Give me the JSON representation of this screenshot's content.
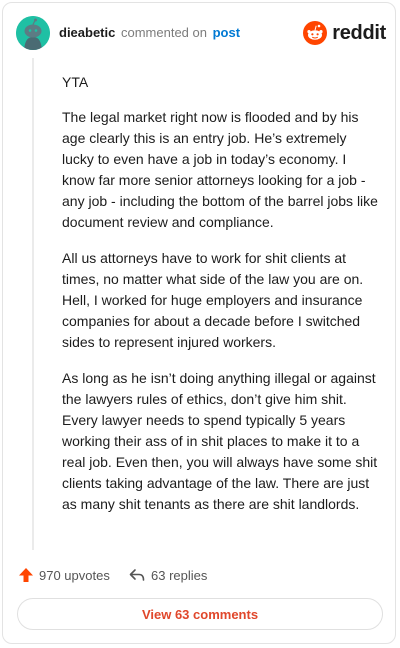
{
  "header": {
    "username": "dieabetic",
    "verb": "commented on",
    "post_link": "post",
    "brand": "reddit"
  },
  "comment": {
    "paragraphs": [
      "YTA",
      "The legal market right now is flooded and by his age clearly this is an entry job. He’s extremely lucky to even have a job in today’s economy. I know far more senior attorneys looking for a job - any job - including the bottom of the barrel jobs like document review and compliance.",
      "All us attorneys have to work for shit clients at times, no matter what side of the law you are on. Hell, I worked for huge employers and insurance companies for about a decade before I switched sides to represent injured workers.",
      "As long as he isn’t doing anything illegal or against the lawyers rules of ethics, don’t give him shit. Every lawyer needs to spend typically 5 years working their ass of in shit places to make it to a real job. Even then, you will always have some shit clients taking advantage of the law. There are just as many shit tenants as there are shit landlords."
    ]
  },
  "actions": {
    "upvotes": "970 upvotes",
    "replies": "63 replies",
    "view_comments": "View 63 comments"
  },
  "colors": {
    "accent": "#ff4500",
    "link": "#0079d3",
    "view_button_text": "#e0472b",
    "avatar_bg": "#1fc0a4"
  },
  "icons": {
    "upvote": "upvote-arrow-icon",
    "reply": "reply-arrow-icon",
    "logo": "reddit-snoo-icon",
    "avatar": "snoo-avatar-icon"
  }
}
